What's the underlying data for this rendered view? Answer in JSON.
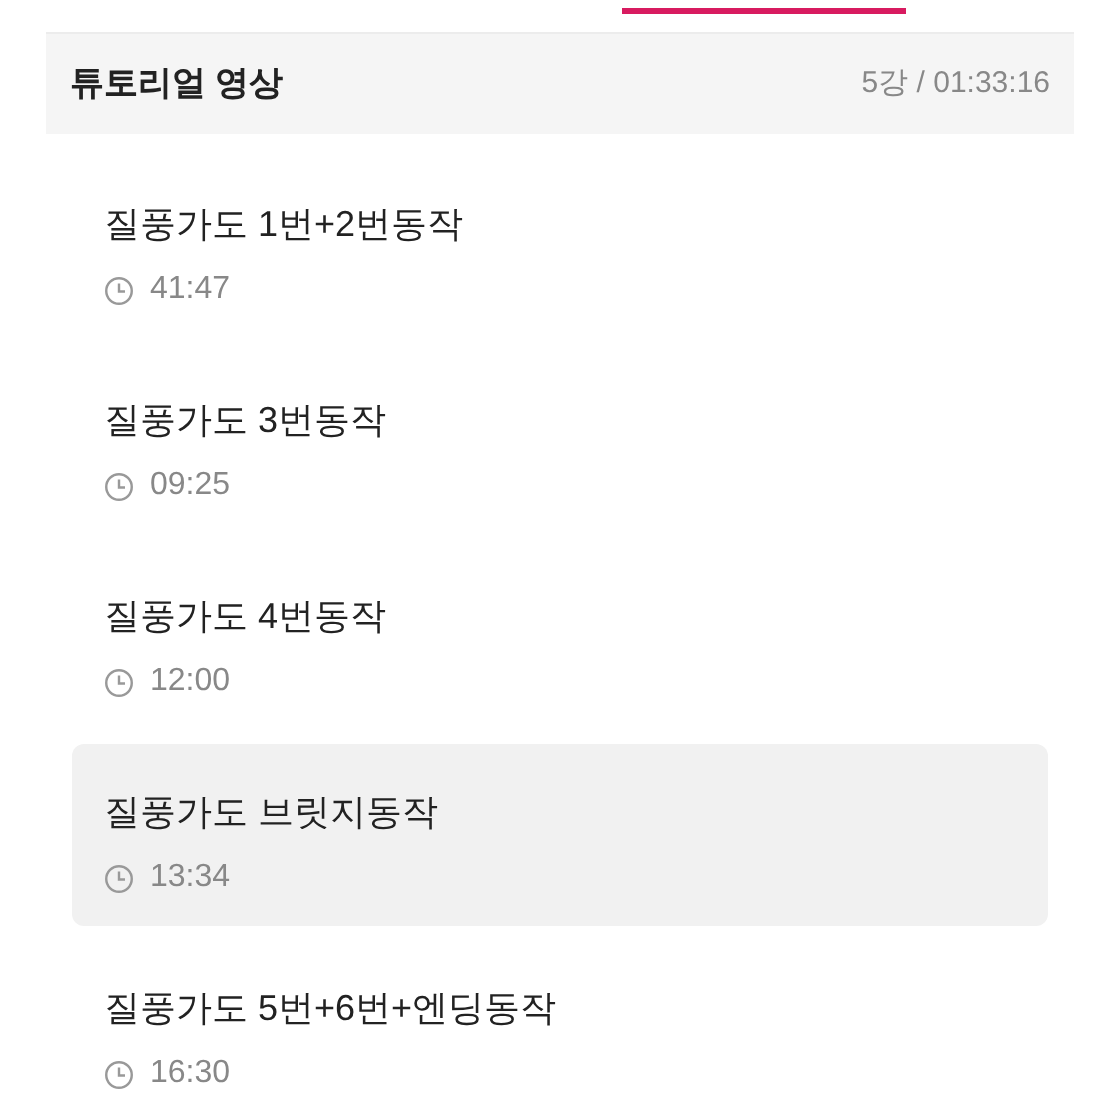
{
  "section": {
    "title": "튜토리얼 영상",
    "summary": "5강 / 01:33:16"
  },
  "lessons": [
    {
      "title": "질풍가도 1번+2번동작",
      "duration": "41:47",
      "selected": false
    },
    {
      "title": "질풍가도 3번동작",
      "duration": "09:25",
      "selected": false
    },
    {
      "title": "질풍가도 4번동작",
      "duration": "12:00",
      "selected": false
    },
    {
      "title": "질풍가도 브릿지동작",
      "duration": "13:34",
      "selected": true
    },
    {
      "title": "질풍가도 5번+6번+엔딩동작",
      "duration": "16:30",
      "selected": false
    }
  ]
}
